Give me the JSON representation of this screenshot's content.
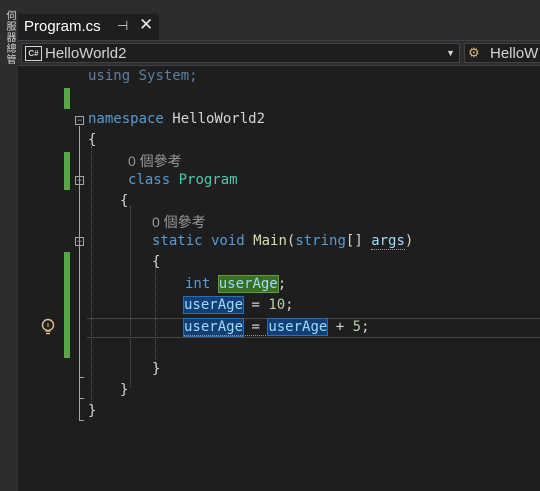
{
  "left_panel": {
    "label": "伺服器總管"
  },
  "tab": {
    "title": "Program.cs",
    "pin": "⊣",
    "close": "✕"
  },
  "navbar": {
    "project": "HelloWorld2",
    "badge": "C#",
    "right": "HelloW"
  },
  "code": {
    "using_kw": "using",
    "using_ns": " System;",
    "ns_kw": "namespace",
    "ns_name": " HelloWorld2",
    "open1": "{",
    "lens1": "0 個參考",
    "class_kw": "class",
    "class_name": " Program",
    "open2": "{",
    "lens2": "0 個參考",
    "static_kw": "static",
    "void_kw": " void ",
    "main": "Main",
    "paren": "(",
    "string_kw": "string",
    "arr": "[] ",
    "args": "args",
    "close_paren": ")",
    "open3": "{",
    "int_kw": "int",
    "var1": "userAge",
    "semi1": ";",
    "var2": "userAge",
    "assign1": " = ",
    "num1": "10",
    "semi2": ";",
    "var3": "userAge",
    "assign2": " = ",
    "var4": "userAge",
    "plus": " + ",
    "num2": "5",
    "semi3": ";",
    "close3": "}",
    "close2": "}",
    "close1": "}"
  }
}
